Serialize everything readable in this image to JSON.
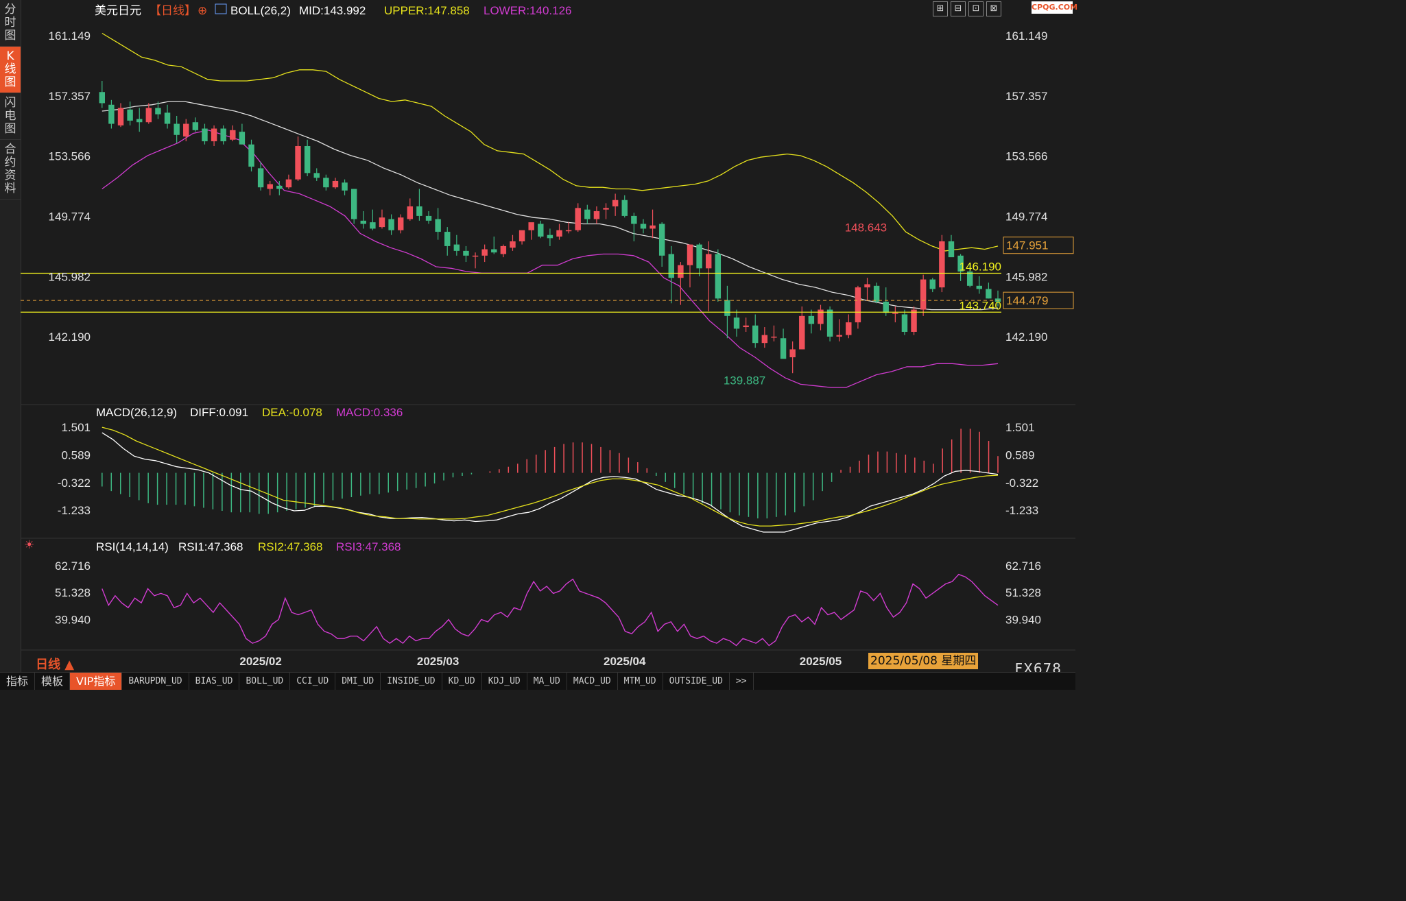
{
  "sidebar": {
    "tabs": [
      "分\n时\n图",
      "K\n线\n图",
      "闪\n电\n图",
      "合\n约\n资\n料"
    ]
  },
  "header": {
    "symbol": "美元日元",
    "period_tag": "【日线】",
    "boll": {
      "name": "BOLL(26,2)",
      "mid": "MID:143.992",
      "upper": "UPPER:147.858",
      "lower": "LOWER:140.126"
    }
  },
  "macd_header": {
    "name": "MACD(26,12,9)",
    "diff": "DIFF:0.091",
    "dea": "DEA:-0.078",
    "macd": "MACD:0.336"
  },
  "rsi_header": {
    "name": "RSI(14,14,14)",
    "rsi1": "RSI1:47.368",
    "rsi2": "RSI2:47.368",
    "rsi3": "RSI3:47.368"
  },
  "toolbar": [
    "⊞",
    "⊟",
    "⊡",
    "⊠"
  ],
  "watermark": "CPQG.COM",
  "brand": "FX678",
  "period_label": "日线 ▲",
  "cursor_date": "2025/05/08 星期四",
  "bottom_tabs": [
    "指标",
    "模板",
    "VIP指标",
    "BARUPDN_UD",
    "BIAS_UD",
    "BOLL_UD",
    "CCI_UD",
    "DMI_UD",
    "INSIDE_UD",
    "KD_UD",
    "KDJ_UD",
    "MA_UD",
    "MACD_UD",
    "MTM_UD",
    "OUTSIDE_UD",
    ">>"
  ],
  "colors": {
    "up": "#f0505a",
    "down": "#3db882",
    "upper": "#e6e21c",
    "mid": "#e0e0e0",
    "lower": "#d23cd2",
    "hline": "#f2f21e",
    "dashed": "#e8a33a"
  },
  "chart_data": [
    {
      "type": "candlestick",
      "y_ticks": [
        "161.149",
        "157.357",
        "153.566",
        "149.774",
        "145.982",
        "142.190"
      ],
      "ylim": [
        138.7,
        162.1
      ],
      "x_ticks": [
        "2025/02",
        "2025/03",
        "2025/04",
        "2025/05"
      ],
      "x_tick_index": [
        17,
        36,
        56,
        77
      ],
      "horizontal_lines": [
        {
          "value": 146.19,
          "label": "146.190"
        },
        {
          "value": 143.74,
          "label": "143.740"
        }
      ],
      "dashed_line": 144.479,
      "right_tags": [
        "147.951",
        "144.479"
      ],
      "annotations": {
        "high": "148.643",
        "high_index": 79,
        "low": "139.887",
        "low_index": 66
      },
      "candles": [
        [
          157.6,
          158.3,
          156.6,
          156.9
        ],
        [
          156.8,
          157.1,
          155.3,
          155.6
        ],
        [
          155.5,
          156.9,
          155.4,
          156.6
        ],
        [
          156.5,
          157.0,
          155.5,
          155.8
        ],
        [
          155.9,
          156.6,
          155.1,
          155.7
        ],
        [
          155.7,
          156.9,
          155.6,
          156.6
        ],
        [
          156.6,
          157.0,
          155.9,
          156.2
        ],
        [
          156.3,
          156.8,
          155.3,
          155.6
        ],
        [
          155.6,
          156.1,
          154.4,
          154.9
        ],
        [
          154.8,
          155.9,
          154.5,
          155.6
        ],
        [
          155.7,
          156.0,
          155.1,
          155.2
        ],
        [
          155.3,
          155.6,
          154.3,
          154.5
        ],
        [
          154.5,
          155.5,
          154.2,
          155.3
        ],
        [
          155.3,
          155.5,
          154.3,
          154.5
        ],
        [
          154.6,
          155.5,
          154.5,
          155.2
        ],
        [
          155.1,
          155.6,
          154.3,
          154.3
        ],
        [
          154.3,
          154.6,
          152.6,
          152.9
        ],
        [
          152.8,
          153.2,
          151.4,
          151.6
        ],
        [
          151.5,
          152.0,
          151.1,
          151.8
        ],
        [
          151.7,
          152.0,
          151.1,
          151.5
        ],
        [
          151.6,
          152.4,
          151.5,
          152.1
        ],
        [
          152.1,
          154.8,
          152.0,
          154.2
        ],
        [
          154.2,
          154.6,
          152.3,
          152.5
        ],
        [
          152.5,
          152.8,
          152.0,
          152.2
        ],
        [
          152.2,
          152.4,
          151.4,
          151.6
        ],
        [
          151.6,
          152.2,
          151.5,
          152.0
        ],
        [
          151.9,
          152.1,
          151.1,
          151.4
        ],
        [
          151.5,
          151.5,
          149.3,
          149.6
        ],
        [
          149.5,
          150.1,
          149.0,
          149.3
        ],
        [
          149.4,
          150.2,
          148.9,
          149.0
        ],
        [
          149.1,
          150.2,
          149.0,
          149.7
        ],
        [
          149.6,
          149.9,
          148.6,
          148.9
        ],
        [
          148.9,
          149.9,
          148.7,
          149.7
        ],
        [
          149.6,
          150.9,
          149.5,
          150.4
        ],
        [
          150.4,
          151.5,
          149.5,
          149.8
        ],
        [
          149.8,
          150.1,
          149.3,
          149.5
        ],
        [
          149.6,
          150.3,
          148.3,
          148.8
        ],
        [
          148.8,
          149.1,
          147.3,
          147.9
        ],
        [
          148.0,
          148.6,
          147.3,
          147.6
        ],
        [
          147.6,
          147.9,
          146.9,
          147.3
        ],
        [
          147.3,
          147.5,
          146.5,
          147.3
        ],
        [
          147.3,
          148.0,
          146.9,
          147.7
        ],
        [
          147.7,
          148.5,
          147.4,
          147.5
        ],
        [
          147.4,
          148.0,
          147.2,
          147.9
        ],
        [
          147.8,
          148.6,
          147.6,
          148.2
        ],
        [
          148.2,
          148.7,
          148.0,
          148.9
        ],
        [
          148.9,
          149.3,
          148.3,
          149.4
        ],
        [
          149.3,
          149.5,
          148.4,
          148.5
        ],
        [
          148.6,
          149.0,
          147.9,
          148.4
        ],
        [
          148.5,
          149.3,
          148.3,
          148.9
        ],
        [
          148.9,
          149.4,
          148.7,
          148.9
        ],
        [
          148.9,
          150.6,
          148.8,
          150.3
        ],
        [
          150.2,
          150.5,
          149.3,
          149.6
        ],
        [
          149.6,
          150.4,
          149.3,
          150.1
        ],
        [
          150.2,
          150.6,
          149.6,
          150.3
        ],
        [
          150.4,
          151.2,
          149.8,
          150.8
        ],
        [
          150.8,
          151.1,
          149.7,
          149.8
        ],
        [
          149.8,
          150.0,
          148.2,
          149.3
        ],
        [
          149.3,
          149.6,
          148.7,
          149.0
        ],
        [
          149.0,
          150.2,
          148.4,
          149.2
        ],
        [
          149.3,
          149.4,
          146.6,
          147.3
        ],
        [
          147.4,
          147.9,
          144.3,
          145.9
        ],
        [
          145.9,
          146.9,
          144.2,
          146.7
        ],
        [
          146.7,
          148.0,
          145.3,
          148.0
        ],
        [
          148.0,
          148.1,
          146.0,
          146.5
        ],
        [
          146.5,
          148.2,
          143.8,
          147.4
        ],
        [
          147.4,
          147.7,
          144.4,
          144.6
        ],
        [
          144.5,
          145.4,
          142.1,
          143.5
        ],
        [
          143.4,
          143.9,
          142.2,
          142.7
        ],
        [
          142.8,
          143.4,
          142.5,
          142.9
        ],
        [
          142.9,
          143.6,
          141.5,
          141.8
        ],
        [
          141.8,
          142.8,
          141.5,
          142.3
        ],
        [
          142.2,
          142.9,
          141.9,
          142.2
        ],
        [
          142.1,
          142.7,
          141.0,
          140.8
        ],
        [
          140.9,
          141.9,
          139.9,
          141.4
        ],
        [
          141.4,
          144.1,
          141.4,
          143.5
        ],
        [
          143.5,
          143.9,
          142.4,
          143.0
        ],
        [
          143.0,
          144.2,
          142.6,
          143.9
        ],
        [
          143.9,
          144.1,
          141.9,
          142.2
        ],
        [
          142.2,
          143.3,
          141.9,
          142.3
        ],
        [
          142.3,
          143.6,
          142.1,
          143.1
        ],
        [
          143.1,
          145.4,
          142.7,
          145.3
        ],
        [
          145.3,
          145.9,
          144.5,
          145.5
        ],
        [
          145.4,
          145.6,
          144.3,
          144.4
        ],
        [
          144.4,
          145.3,
          143.5,
          143.7
        ],
        [
          143.7,
          144.1,
          143.1,
          143.7
        ],
        [
          143.6,
          143.9,
          142.3,
          142.5
        ],
        [
          142.5,
          144.1,
          142.3,
          143.9
        ],
        [
          143.9,
          146.1,
          143.5,
          145.8
        ],
        [
          145.8,
          145.9,
          145.0,
          145.2
        ],
        [
          145.3,
          148.6,
          145.0,
          148.2
        ],
        [
          148.2,
          148.6,
          147.4,
          147.2
        ],
        [
          147.3,
          147.4,
          145.7,
          146.3
        ],
        [
          146.3,
          146.8,
          145.3,
          145.4
        ],
        [
          145.4,
          146.0,
          144.9,
          145.2
        ],
        [
          145.2,
          145.6,
          144.6,
          144.6
        ],
        [
          144.6,
          145.1,
          144.1,
          144.4
        ]
      ],
      "upper": [
        161.3,
        160.8,
        160.3,
        159.8,
        159.6,
        159.3,
        159.2,
        158.8,
        158.4,
        158.3,
        158.3,
        158.3,
        158.4,
        158.5,
        158.8,
        159.0,
        159.0,
        158.9,
        158.4,
        158.0,
        157.6,
        157.2,
        157.0,
        157.1,
        156.9,
        156.7,
        156.1,
        155.6,
        155.1,
        154.3,
        153.9,
        153.8,
        153.7,
        153.2,
        152.7,
        152.1,
        151.7,
        151.6,
        151.6,
        151.5,
        151.5,
        151.4,
        151.5,
        151.6,
        151.7,
        151.8,
        152.0,
        152.4,
        152.9,
        153.3,
        153.5,
        153.6,
        153.7,
        153.6,
        153.3,
        152.9,
        152.4,
        151.9,
        151.3,
        150.6,
        149.8,
        148.8,
        148.3,
        147.9,
        147.6,
        147.7,
        147.8,
        147.7,
        147.9
      ],
      "mid": [
        156.4,
        156.5,
        156.7,
        156.8,
        157.0,
        157.0,
        156.8,
        156.6,
        156.4,
        156.1,
        155.7,
        155.3,
        154.9,
        154.5,
        154.0,
        153.6,
        153.3,
        152.8,
        152.4,
        151.9,
        151.5,
        151.1,
        150.8,
        150.5,
        150.2,
        149.9,
        149.7,
        149.6,
        149.4,
        149.3,
        149.3,
        149.1,
        148.7,
        148.5,
        148.3,
        148.1,
        147.8,
        147.5,
        147.1,
        146.6,
        146.2,
        145.8,
        145.5,
        145.3,
        145.0,
        144.8,
        144.5,
        144.3,
        144.1,
        144.0,
        143.9,
        143.9,
        143.9,
        143.9,
        144.0
      ],
      "lower": [
        151.5,
        152.2,
        153.0,
        153.6,
        154.0,
        154.4,
        155.0,
        155.2,
        154.9,
        154.6,
        153.7,
        152.5,
        151.4,
        151.2,
        150.8,
        150.4,
        149.8,
        148.7,
        148.2,
        147.8,
        147.5,
        147.1,
        146.6,
        146.5,
        146.3,
        146.2,
        146.2,
        146.2,
        146.2,
        146.7,
        146.7,
        147.1,
        147.3,
        147.4,
        147.4,
        147.3,
        146.9,
        145.9,
        145.4,
        144.3,
        143.2,
        142.4,
        141.5,
        140.9,
        140.2,
        139.6,
        139.2,
        139.1,
        139.0,
        139.0,
        139.4,
        139.8,
        140.0,
        140.3,
        140.3,
        140.5,
        140.5,
        140.4,
        140.4,
        140.5
      ]
    },
    {
      "type": "macd",
      "y_ticks": [
        "1.501",
        "0.589",
        "-0.322",
        "-1.233"
      ],
      "ylim": [
        -1.95,
        1.75
      ],
      "diff": [
        1.32,
        1.1,
        0.8,
        0.55,
        0.45,
        0.4,
        0.3,
        0.2,
        0.15,
        0.1,
        0.0,
        -0.2,
        -0.4,
        -0.55,
        -0.6,
        -0.8,
        -1.0,
        -1.15,
        -1.25,
        -1.23,
        -1.1,
        -1.1,
        -1.15,
        -1.2,
        -1.3,
        -1.35,
        -1.45,
        -1.5,
        -1.5,
        -1.48,
        -1.47,
        -1.5,
        -1.55,
        -1.58,
        -1.55,
        -1.6,
        -1.58,
        -1.55,
        -1.45,
        -1.35,
        -1.3,
        -1.18,
        -1.0,
        -0.85,
        -0.65,
        -0.45,
        -0.25,
        -0.15,
        -0.12,
        -0.15,
        -0.2,
        -0.35,
        -0.55,
        -0.65,
        -0.75,
        -0.8,
        -0.9,
        -1.05,
        -1.3,
        -1.55,
        -1.75,
        -1.85,
        -1.95,
        -1.95,
        -1.95,
        -1.85,
        -1.75,
        -1.65,
        -1.6,
        -1.55,
        -1.45,
        -1.3,
        -1.1,
        -1.0,
        -0.9,
        -0.8,
        -0.7,
        -0.55,
        -0.35,
        -0.1,
        0.05,
        0.08,
        0.05,
        0.0,
        -0.05
      ],
      "dea": [
        1.5,
        1.4,
        1.25,
        1.05,
        0.9,
        0.75,
        0.6,
        0.45,
        0.3,
        0.15,
        0.0,
        -0.15,
        -0.3,
        -0.45,
        -0.6,
        -0.75,
        -0.9,
        -0.95,
        -1.0,
        -1.05,
        -1.1,
        -1.15,
        -1.25,
        -1.35,
        -1.42,
        -1.45,
        -1.5,
        -1.5,
        -1.52,
        -1.52,
        -1.52,
        -1.52,
        -1.5,
        -1.45,
        -1.4,
        -1.3,
        -1.2,
        -1.1,
        -1.0,
        -0.88,
        -0.75,
        -0.6,
        -0.48,
        -0.35,
        -0.25,
        -0.2,
        -0.2,
        -0.25,
        -0.32,
        -0.4,
        -0.55,
        -0.7,
        -0.85,
        -1.05,
        -1.25,
        -1.45,
        -1.6,
        -1.7,
        -1.75,
        -1.75,
        -1.72,
        -1.7,
        -1.65,
        -1.6,
        -1.52,
        -1.45,
        -1.4,
        -1.3,
        -1.2,
        -1.08,
        -0.95,
        -0.8,
        -0.65,
        -0.5,
        -0.38,
        -0.3,
        -0.22,
        -0.15,
        -0.1,
        -0.08
      ],
      "hist": [
        -0.45,
        -0.6,
        -0.7,
        -0.8,
        -0.9,
        -1.0,
        -1.05,
        -1.05,
        -1.05,
        -1.05,
        -1.1,
        -1.15,
        -1.2,
        -1.25,
        -1.3,
        -1.3,
        -1.3,
        -1.35,
        -1.35,
        -1.3,
        -1.25,
        -1.2,
        -1.15,
        -1.1,
        -1.0,
        -0.9,
        -0.85,
        -0.8,
        -0.75,
        -0.7,
        -0.7,
        -0.65,
        -0.6,
        -0.55,
        -0.5,
        -0.45,
        -0.35,
        -0.25,
        -0.15,
        -0.1,
        -0.05,
        0.0,
        0.05,
        0.12,
        0.2,
        0.3,
        0.45,
        0.6,
        0.75,
        0.85,
        0.95,
        1.0,
        1.0,
        0.95,
        0.85,
        0.75,
        0.65,
        0.5,
        0.35,
        0.15,
        -0.1,
        -0.3,
        -0.5,
        -0.7,
        -0.85,
        -1.0,
        -1.1,
        -1.2,
        -1.3,
        -1.4,
        -1.45,
        -1.5,
        -1.5,
        -1.45,
        -1.4,
        -1.3,
        -1.1,
        -0.9,
        -0.6,
        -0.3,
        0.1,
        0.2,
        0.4,
        0.6,
        0.7,
        0.7,
        0.65,
        0.6,
        0.5,
        0.4,
        0.3,
        0.8,
        1.1,
        1.45,
        1.45,
        1.35,
        1.05,
        0.55
      ],
      "hist_pos_color": "#f0505a",
      "hist_neg_color": "#3db882"
    },
    {
      "type": "line",
      "y_ticks": [
        "62.716",
        "51.328",
        "39.940"
      ],
      "ylim": [
        28,
        67
      ],
      "rsi": [
        53,
        46,
        50,
        47,
        45,
        49,
        47,
        53,
        50,
        51,
        50,
        45,
        46,
        51,
        47,
        49,
        46,
        43,
        47,
        44,
        41,
        38,
        32,
        30,
        31,
        33,
        38,
        40,
        49,
        43,
        42,
        43,
        44,
        38,
        35,
        34,
        32,
        32,
        33,
        33,
        31,
        34,
        37,
        32,
        30,
        32,
        30,
        33,
        31,
        32,
        32,
        35,
        37,
        40,
        36,
        34,
        33,
        36,
        40,
        39,
        42,
        43,
        41,
        45,
        44,
        51,
        56,
        52,
        54,
        51,
        52,
        55,
        57,
        52,
        51,
        50,
        49,
        47,
        44,
        41,
        35,
        34,
        37,
        39,
        43,
        35,
        38,
        39,
        35,
        38,
        33,
        32,
        33,
        31,
        30,
        32,
        31,
        29,
        32,
        31,
        30,
        32,
        29,
        31,
        37,
        41,
        42,
        39,
        41,
        38,
        45,
        42,
        43,
        40,
        42,
        44,
        52,
        51,
        48,
        51,
        45,
        41,
        43,
        47,
        55,
        53,
        49,
        51,
        53,
        55,
        56,
        59,
        58,
        56,
        53,
        50,
        48,
        46
      ]
    }
  ]
}
